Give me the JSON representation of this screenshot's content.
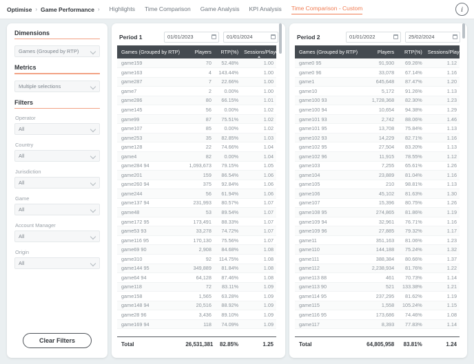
{
  "header": {
    "breadcrumb": [
      "Optimise",
      "Game Performance"
    ],
    "separator": "›",
    "tabs": [
      {
        "label": "Highlights",
        "active": false
      },
      {
        "label": "Time Comparison",
        "active": false
      },
      {
        "label": "Game Analysis",
        "active": false
      },
      {
        "label": "KPI Analysis",
        "active": false
      },
      {
        "label": "Time Comparison - Custom",
        "active": true
      }
    ],
    "info_icon": "info-icon",
    "accent_color": "#f07c53"
  },
  "sidebar": {
    "sections": [
      {
        "title": "Dimensions",
        "fields": [
          {
            "label": "",
            "value": "Games (Grouped by RTP)"
          }
        ]
      },
      {
        "title": "Metrics",
        "fields": [
          {
            "label": "",
            "value": "Multiple selections"
          }
        ]
      },
      {
        "title": "Filters",
        "fields": [
          {
            "label": "Operator",
            "value": "All"
          },
          {
            "label": "Country",
            "value": "All"
          },
          {
            "label": "Jurisdiction",
            "value": "All"
          },
          {
            "label": "Game",
            "value": "All"
          },
          {
            "label": "Account Manager",
            "value": "All"
          },
          {
            "label": "Origin",
            "value": "All"
          }
        ]
      }
    ],
    "clear_filters_label": "Clear Filters"
  },
  "chart_data": {
    "type": "table",
    "title": "Time Comparison - Custom",
    "panels": [
      {
        "title": "Period 1",
        "date_from": "01/01/2023",
        "date_to": "01/01/2024",
        "columns": [
          "Games (Grouped by RTP)",
          "Players",
          "RTP(%)",
          "Sessions/Player"
        ],
        "sort_column": "Sessions/Player",
        "sort_direction": "asc",
        "rows": [
          [
            "game159",
            "70",
            "52.48%",
            "1.00"
          ],
          [
            "game163",
            "4",
            "143.44%",
            "1.00"
          ],
          [
            "game287",
            "7",
            "22.66%",
            "1.00"
          ],
          [
            "game7",
            "2",
            "0.00%",
            "1.00"
          ],
          [
            "game286",
            "80",
            "66.15%",
            "1.01"
          ],
          [
            "game145",
            "56",
            "0.00%",
            "1.02"
          ],
          [
            "game99",
            "87",
            "75.51%",
            "1.02"
          ],
          [
            "game107",
            "85",
            "0.00%",
            "1.02"
          ],
          [
            "game253",
            "35",
            "82.85%",
            "1.03"
          ],
          [
            "game128",
            "22",
            "74.66%",
            "1.04"
          ],
          [
            "game4",
            "82",
            "0.00%",
            "1.04"
          ],
          [
            "game284 94",
            "1,093,673",
            "79.15%",
            "1.05"
          ],
          [
            "game201",
            "159",
            "86.54%",
            "1.06"
          ],
          [
            "game260 94",
            "375",
            "92.84%",
            "1.06"
          ],
          [
            "game244",
            "56",
            "61.94%",
            "1.06"
          ],
          [
            "game137 94",
            "231,993",
            "80.57%",
            "1.07"
          ],
          [
            "game48",
            "53",
            "89.54%",
            "1.07"
          ],
          [
            "game172 95",
            "173,491",
            "88.33%",
            "1.07"
          ],
          [
            "game53 93",
            "33,278",
            "74.72%",
            "1.07"
          ],
          [
            "game116 95",
            "170,130",
            "75.56%",
            "1.07"
          ],
          [
            "game69 90",
            "2,908",
            "84.68%",
            "1.08"
          ],
          [
            "game310",
            "92",
            "114.75%",
            "1.08"
          ],
          [
            "game144 95",
            "349,889",
            "81.84%",
            "1.08"
          ],
          [
            "game64 94",
            "64,128",
            "87.46%",
            "1.08"
          ],
          [
            "game118",
            "72",
            "83.11%",
            "1.09"
          ],
          [
            "game158",
            "1,565",
            "63.28%",
            "1.09"
          ],
          [
            "game148 94",
            "20,516",
            "88.92%",
            "1.09"
          ],
          [
            "game28 96",
            "3,436",
            "89.10%",
            "1.09"
          ],
          [
            "game169 94",
            "118",
            "74.09%",
            "1.09"
          ]
        ],
        "total": [
          "Total",
          "26,531,381",
          "82.85%",
          "1.25"
        ]
      },
      {
        "title": "Period 2",
        "date_from": "01/01/2022",
        "date_to": "25/02/2024",
        "columns": [
          "Games (Grouped by RTP)",
          "Players",
          "RTP(%)",
          "Sessions/Player"
        ],
        "sort_column": "",
        "sort_direction": "",
        "rows": [
          [
            "game0 95",
            "91,930",
            "69.26%",
            "1.12"
          ],
          [
            "game0 96",
            "33,078",
            "67.14%",
            "1.16"
          ],
          [
            "game1",
            "645,648",
            "87.47%",
            "1.20"
          ],
          [
            "game10",
            "5,172",
            "91.26%",
            "1.13"
          ],
          [
            "game100 93",
            "1,728,368",
            "82.30%",
            "1.23"
          ],
          [
            "game100 94",
            "10,654",
            "94.38%",
            "1.29"
          ],
          [
            "game101 93",
            "2,742",
            "88.06%",
            "1.46"
          ],
          [
            "game101 95",
            "13,708",
            "75.84%",
            "1.13"
          ],
          [
            "game102 93",
            "14,229",
            "82.71%",
            "1.16"
          ],
          [
            "game102 95",
            "27,504",
            "83.20%",
            "1.13"
          ],
          [
            "game102 96",
            "11,915",
            "78.55%",
            "1.12"
          ],
          [
            "game103",
            "7,255",
            "65.61%",
            "1.26"
          ],
          [
            "game104",
            "23,889",
            "81.04%",
            "1.16"
          ],
          [
            "game105",
            "210",
            "98.81%",
            "1.13"
          ],
          [
            "game106",
            "45,102",
            "81.63%",
            "1.30"
          ],
          [
            "game107",
            "15,396",
            "80.75%",
            "1.26"
          ],
          [
            "game108 95",
            "274,865",
            "81.86%",
            "1.19"
          ],
          [
            "game109 94",
            "32,961",
            "76.71%",
            "1.16"
          ],
          [
            "game109 96",
            "27,885",
            "79.32%",
            "1.17"
          ],
          [
            "game11",
            "351,163",
            "81.06%",
            "1.23"
          ],
          [
            "game110",
            "144,188",
            "75.24%",
            "1.32"
          ],
          [
            "game111",
            "388,384",
            "80.66%",
            "1.37"
          ],
          [
            "game112",
            "2,238,934",
            "81.76%",
            "1.22"
          ],
          [
            "game113 88",
            "461",
            "70.73%",
            "1.14"
          ],
          [
            "game113 90",
            "521",
            "133.38%",
            "1.21"
          ],
          [
            "game114 95",
            "237,295",
            "81.62%",
            "1.19"
          ],
          [
            "game115",
            "1,558",
            "105.24%",
            "1.15"
          ],
          [
            "game116 95",
            "173,686",
            "74.46%",
            "1.08"
          ],
          [
            "game117",
            "8,393",
            "77.83%",
            "1.14"
          ]
        ],
        "total": [
          "Total",
          "64,805,958",
          "83.81%",
          "1.24"
        ]
      }
    ]
  }
}
